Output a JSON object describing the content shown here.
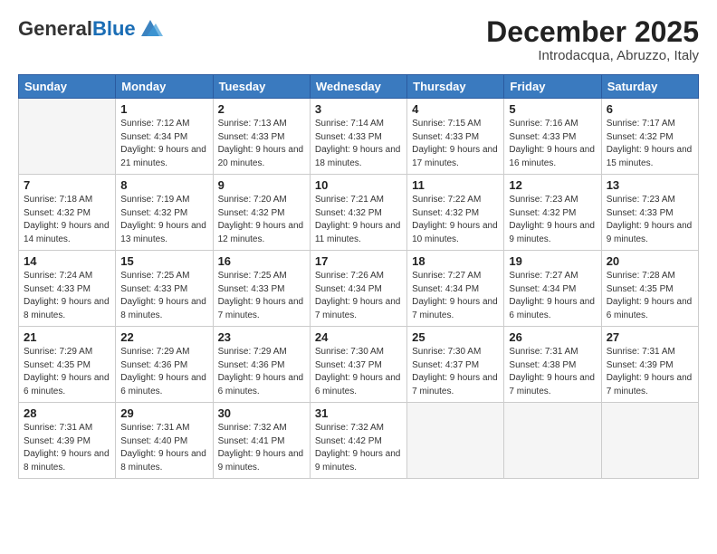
{
  "header": {
    "logo_general": "General",
    "logo_blue": "Blue",
    "month_title": "December 2025",
    "location": "Introdacqua, Abruzzo, Italy"
  },
  "weekdays": [
    "Sunday",
    "Monday",
    "Tuesday",
    "Wednesday",
    "Thursday",
    "Friday",
    "Saturday"
  ],
  "weeks": [
    [
      {
        "day": "",
        "empty": true
      },
      {
        "day": "1",
        "sunrise": "7:12 AM",
        "sunset": "4:34 PM",
        "daylight": "9 hours and 21 minutes."
      },
      {
        "day": "2",
        "sunrise": "7:13 AM",
        "sunset": "4:33 PM",
        "daylight": "9 hours and 20 minutes."
      },
      {
        "day": "3",
        "sunrise": "7:14 AM",
        "sunset": "4:33 PM",
        "daylight": "9 hours and 18 minutes."
      },
      {
        "day": "4",
        "sunrise": "7:15 AM",
        "sunset": "4:33 PM",
        "daylight": "9 hours and 17 minutes."
      },
      {
        "day": "5",
        "sunrise": "7:16 AM",
        "sunset": "4:33 PM",
        "daylight": "9 hours and 16 minutes."
      },
      {
        "day": "6",
        "sunrise": "7:17 AM",
        "sunset": "4:32 PM",
        "daylight": "9 hours and 15 minutes."
      }
    ],
    [
      {
        "day": "7",
        "sunrise": "7:18 AM",
        "sunset": "4:32 PM",
        "daylight": "9 hours and 14 minutes."
      },
      {
        "day": "8",
        "sunrise": "7:19 AM",
        "sunset": "4:32 PM",
        "daylight": "9 hours and 13 minutes."
      },
      {
        "day": "9",
        "sunrise": "7:20 AM",
        "sunset": "4:32 PM",
        "daylight": "9 hours and 12 minutes."
      },
      {
        "day": "10",
        "sunrise": "7:21 AM",
        "sunset": "4:32 PM",
        "daylight": "9 hours and 11 minutes."
      },
      {
        "day": "11",
        "sunrise": "7:22 AM",
        "sunset": "4:32 PM",
        "daylight": "9 hours and 10 minutes."
      },
      {
        "day": "12",
        "sunrise": "7:23 AM",
        "sunset": "4:32 PM",
        "daylight": "9 hours and 9 minutes."
      },
      {
        "day": "13",
        "sunrise": "7:23 AM",
        "sunset": "4:33 PM",
        "daylight": "9 hours and 9 minutes."
      }
    ],
    [
      {
        "day": "14",
        "sunrise": "7:24 AM",
        "sunset": "4:33 PM",
        "daylight": "9 hours and 8 minutes."
      },
      {
        "day": "15",
        "sunrise": "7:25 AM",
        "sunset": "4:33 PM",
        "daylight": "9 hours and 8 minutes."
      },
      {
        "day": "16",
        "sunrise": "7:25 AM",
        "sunset": "4:33 PM",
        "daylight": "9 hours and 7 minutes."
      },
      {
        "day": "17",
        "sunrise": "7:26 AM",
        "sunset": "4:34 PM",
        "daylight": "9 hours and 7 minutes."
      },
      {
        "day": "18",
        "sunrise": "7:27 AM",
        "sunset": "4:34 PM",
        "daylight": "9 hours and 7 minutes."
      },
      {
        "day": "19",
        "sunrise": "7:27 AM",
        "sunset": "4:34 PM",
        "daylight": "9 hours and 6 minutes."
      },
      {
        "day": "20",
        "sunrise": "7:28 AM",
        "sunset": "4:35 PM",
        "daylight": "9 hours and 6 minutes."
      }
    ],
    [
      {
        "day": "21",
        "sunrise": "7:29 AM",
        "sunset": "4:35 PM",
        "daylight": "9 hours and 6 minutes."
      },
      {
        "day": "22",
        "sunrise": "7:29 AM",
        "sunset": "4:36 PM",
        "daylight": "9 hours and 6 minutes."
      },
      {
        "day": "23",
        "sunrise": "7:29 AM",
        "sunset": "4:36 PM",
        "daylight": "9 hours and 6 minutes."
      },
      {
        "day": "24",
        "sunrise": "7:30 AM",
        "sunset": "4:37 PM",
        "daylight": "9 hours and 6 minutes."
      },
      {
        "day": "25",
        "sunrise": "7:30 AM",
        "sunset": "4:37 PM",
        "daylight": "9 hours and 7 minutes."
      },
      {
        "day": "26",
        "sunrise": "7:31 AM",
        "sunset": "4:38 PM",
        "daylight": "9 hours and 7 minutes."
      },
      {
        "day": "27",
        "sunrise": "7:31 AM",
        "sunset": "4:39 PM",
        "daylight": "9 hours and 7 minutes."
      }
    ],
    [
      {
        "day": "28",
        "sunrise": "7:31 AM",
        "sunset": "4:39 PM",
        "daylight": "9 hours and 8 minutes."
      },
      {
        "day": "29",
        "sunrise": "7:31 AM",
        "sunset": "4:40 PM",
        "daylight": "9 hours and 8 minutes."
      },
      {
        "day": "30",
        "sunrise": "7:32 AM",
        "sunset": "4:41 PM",
        "daylight": "9 hours and 9 minutes."
      },
      {
        "day": "31",
        "sunrise": "7:32 AM",
        "sunset": "4:42 PM",
        "daylight": "9 hours and 9 minutes."
      },
      {
        "day": "",
        "empty": true
      },
      {
        "day": "",
        "empty": true
      },
      {
        "day": "",
        "empty": true
      }
    ]
  ]
}
